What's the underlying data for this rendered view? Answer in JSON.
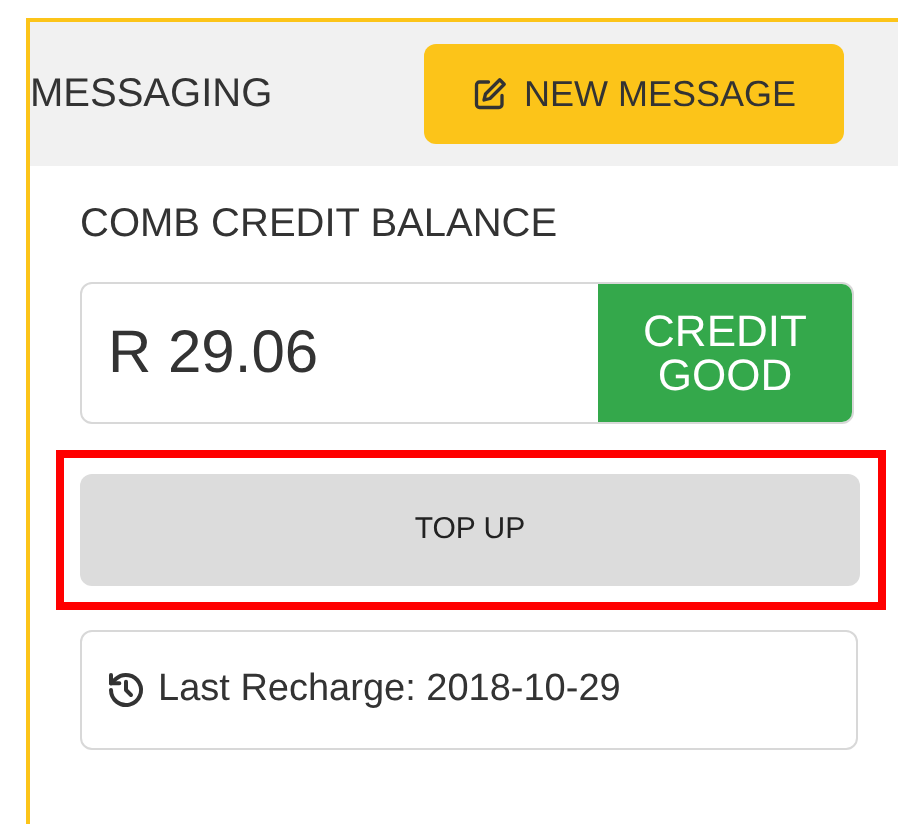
{
  "header": {
    "title": "MESSAGING",
    "new_message_button": "NEW MESSAGE"
  },
  "credit": {
    "heading": "COMB CREDIT BALANCE",
    "balance": "R 29.06",
    "status_lines": [
      "CREDIT",
      "GOOD"
    ],
    "top_up_button": "TOP UP",
    "top_up_highlighted": true,
    "last_recharge": "Last Recharge: 2018-10-29"
  }
}
